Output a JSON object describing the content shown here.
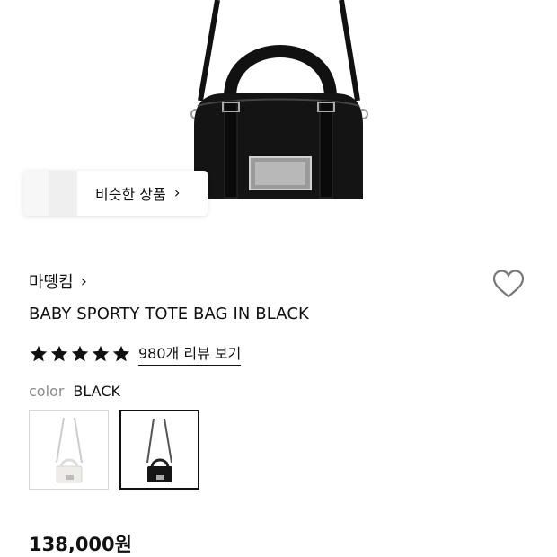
{
  "product_image": {
    "icon": "black-tote-bag-image"
  },
  "similar_products": {
    "label": "비슷한 상품",
    "chevron": "›"
  },
  "brand": {
    "name": "마뗑킴",
    "chevron": "›"
  },
  "wishlist": {
    "icon": "heart-outline-icon"
  },
  "product": {
    "title": "BABY SPORTY TOTE BAG IN BLACK",
    "price": "138,000원"
  },
  "rating": {
    "stars": 5,
    "max": 5,
    "review_link": "980개 리뷰 보기"
  },
  "color": {
    "label": "color",
    "selected": "BLACK",
    "options": [
      "white",
      "black"
    ]
  },
  "colors": {
    "star": "#111111",
    "selected_border": "#111111"
  }
}
